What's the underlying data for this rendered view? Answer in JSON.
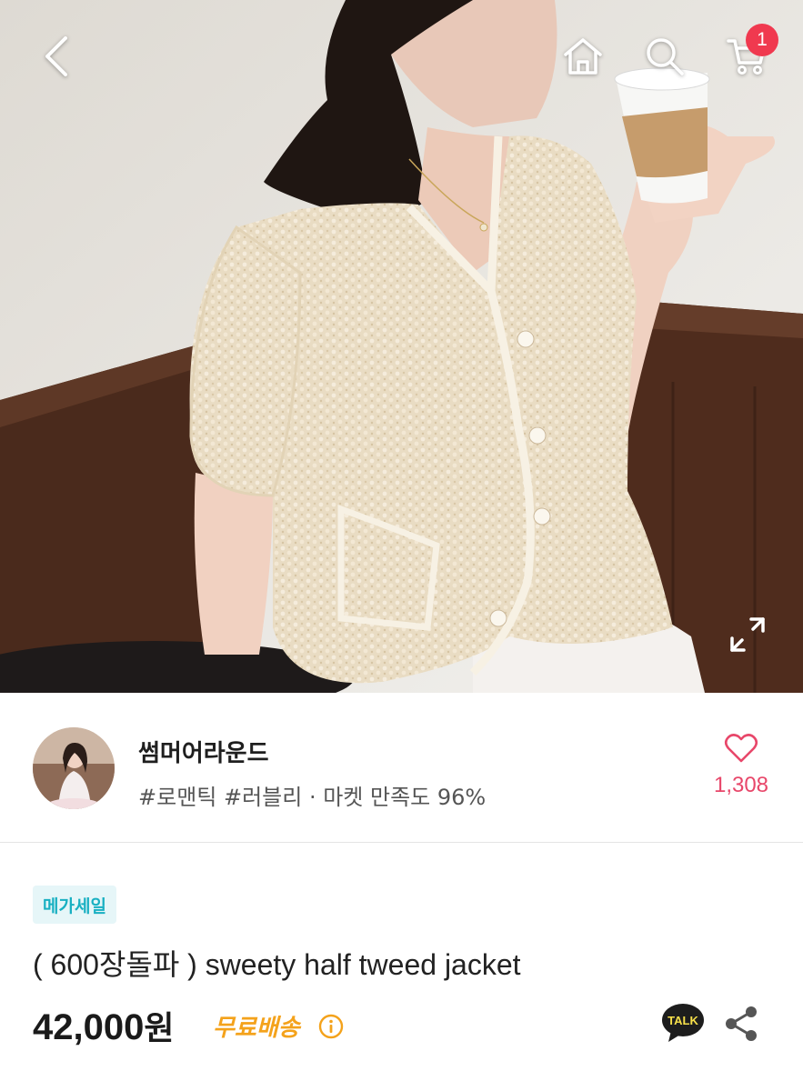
{
  "header": {
    "back_icon": "chevron-left-icon",
    "home_icon": "home-icon",
    "search_icon": "search-icon",
    "cart_icon": "cart-icon",
    "cart_badge": "1",
    "expand_icon": "expand-icon"
  },
  "seller": {
    "name": "썸머어라운드",
    "tags": "#로맨틱 #러블리 · 마켓 만족도 96%",
    "like_count": "1,308",
    "like_icon": "heart-outline-icon"
  },
  "product": {
    "badge": "메가세일",
    "title": "( 600장돌파 ) sweety half tweed jacket",
    "price_number": "42,000",
    "price_unit": "원",
    "shipping": "무료배송",
    "talk_label": "TALK"
  },
  "colors": {
    "accent_pink": "#e8476a",
    "badge_red": "#f0394f",
    "mega_sale": "#19b0c2",
    "free_shipping": "#f4a21b",
    "kakao": "#1d1d1d"
  }
}
